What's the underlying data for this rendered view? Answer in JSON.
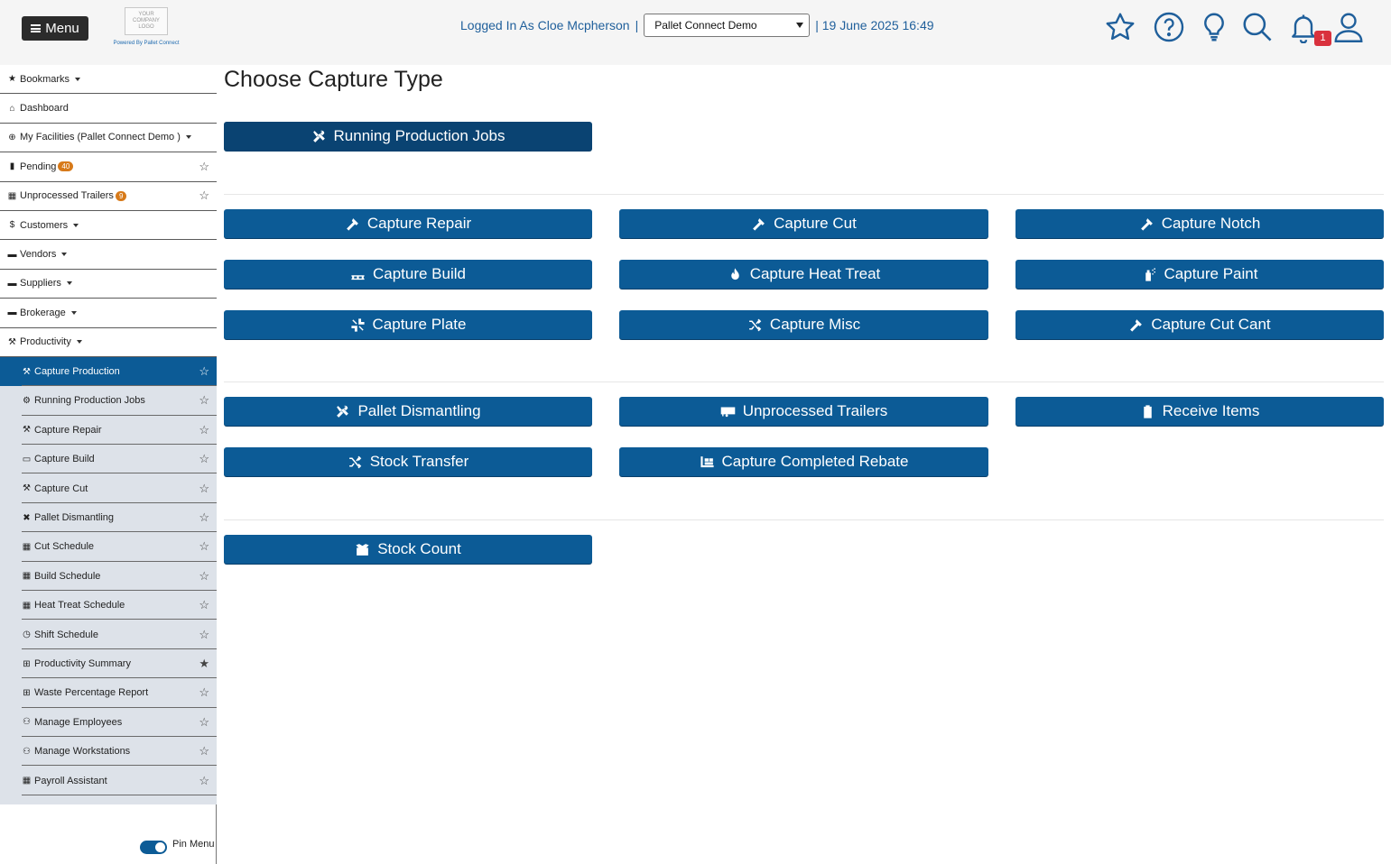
{
  "header": {
    "menu_label": "Menu",
    "logo_lines": [
      "YOUR",
      "COMPANY",
      "LOGO"
    ],
    "powered_by": "Powered By Pallet Connect",
    "logged_in": "Logged In As Cloe Mcpherson",
    "separator": "|",
    "facility_selected": "Pallet Connect Demo",
    "datetime": "| 19 June 2025 16:49",
    "notification_count": "1",
    "icons": [
      "star-icon",
      "help-icon",
      "lightbulb-icon",
      "search-icon",
      "bell-icon",
      "user-icon"
    ]
  },
  "sidebar": {
    "items": [
      {
        "label": "Bookmarks",
        "icon": "star-icon",
        "dropdown": true
      },
      {
        "label": "Dashboard",
        "icon": "home-icon"
      },
      {
        "label": "My Facilities  (Pallet Connect Demo )",
        "icon": "globe-icon",
        "dropdown": true
      },
      {
        "label": "Pending",
        "icon": "clipboard-icon",
        "badge": "40",
        "star": true
      },
      {
        "label": "Unprocessed Trailers",
        "icon": "trailer-icon",
        "badge": "9",
        "star": true
      },
      {
        "label": "Customers",
        "icon": "dollar-icon",
        "dropdown": true
      },
      {
        "label": "Vendors",
        "icon": "truck-icon",
        "dropdown": true
      },
      {
        "label": "Suppliers",
        "icon": "truck-loading-icon",
        "dropdown": true
      },
      {
        "label": "Brokerage",
        "icon": "truck-icon",
        "dropdown": true
      },
      {
        "label": "Productivity",
        "icon": "hammer-icon",
        "dropdown": true
      }
    ],
    "sub_items": [
      {
        "label": "Capture Production",
        "icon": "hammer-icon",
        "active": true
      },
      {
        "label": "Running Production Jobs",
        "icon": "cog-icon"
      },
      {
        "label": "Capture Repair",
        "icon": "hammer-icon"
      },
      {
        "label": "Capture Build",
        "icon": "pallet-icon"
      },
      {
        "label": "Capture Cut",
        "icon": "hammer-icon"
      },
      {
        "label": "Pallet Dismantling",
        "icon": "tools-icon"
      },
      {
        "label": "Cut Schedule",
        "icon": "calendar-icon"
      },
      {
        "label": "Build Schedule",
        "icon": "calendar-icon"
      },
      {
        "label": "Heat Treat Schedule",
        "icon": "calendar-icon"
      },
      {
        "label": "Shift Schedule",
        "icon": "clock-icon"
      },
      {
        "label": "Productivity Summary",
        "icon": "table-icon",
        "starred": true
      },
      {
        "label": "Waste Percentage Report",
        "icon": "table-icon"
      },
      {
        "label": "Manage Employees",
        "icon": "users-icon"
      },
      {
        "label": "Manage Workstations",
        "icon": "users-icon"
      },
      {
        "label": "Payroll Assistant",
        "icon": "calendar-icon"
      }
    ],
    "pin_label": "Pin Menu"
  },
  "main": {
    "title": "Choose Capture Type",
    "running_jobs": "Running Production Jobs",
    "group1": [
      "Capture Repair",
      "Capture Cut",
      "Capture Notch",
      "Capture Build",
      "Capture Heat Treat",
      "Capture Paint",
      "Capture Plate",
      "Capture Misc",
      "Capture Cut Cant"
    ],
    "group2": [
      "Pallet Dismantling",
      "Unprocessed Trailers",
      "Receive Items",
      "Stock Transfer",
      "Capture Completed Rebate"
    ],
    "group3": [
      "Stock Count"
    ]
  }
}
